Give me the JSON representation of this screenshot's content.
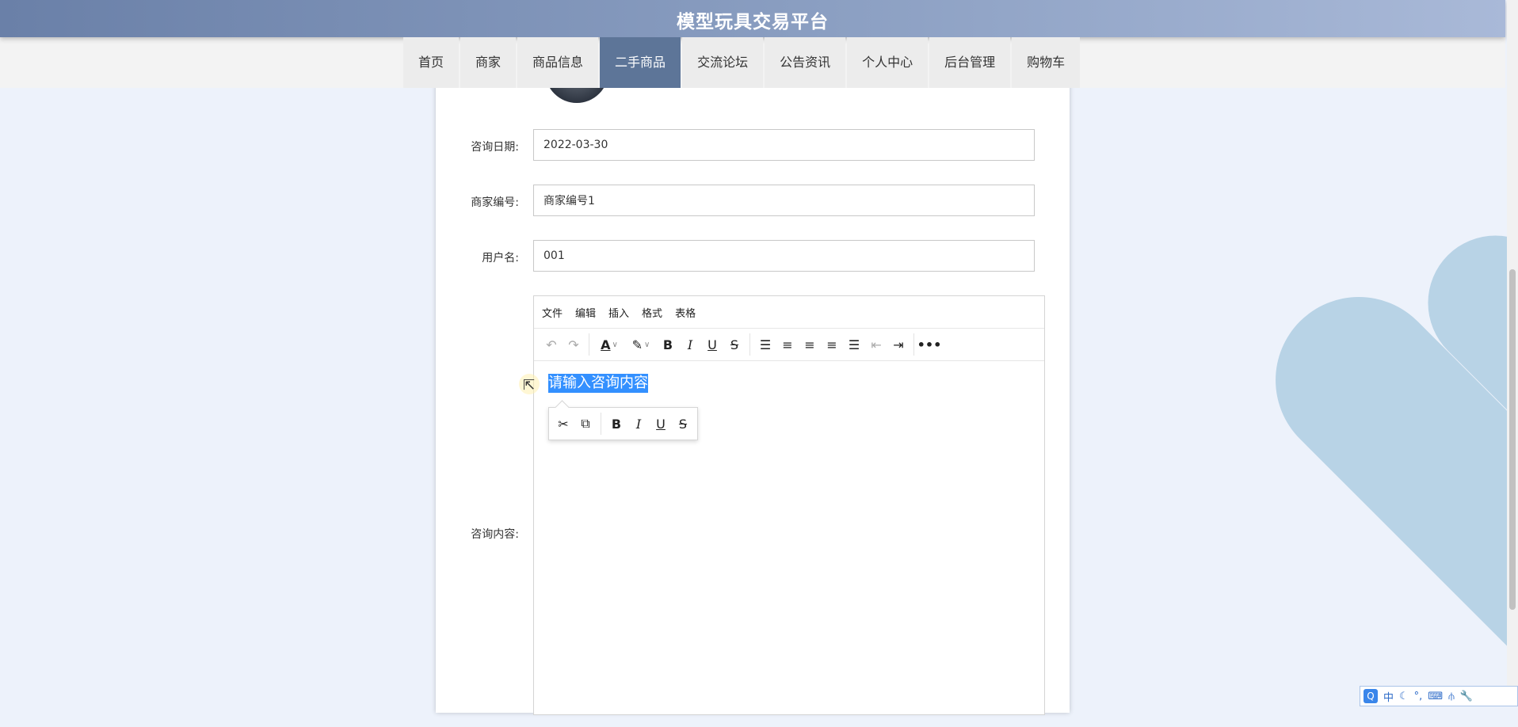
{
  "site": {
    "title": "模型玩具交易平台"
  },
  "nav": {
    "items": [
      {
        "label": "首页"
      },
      {
        "label": "商家"
      },
      {
        "label": "商品信息"
      },
      {
        "label": "二手商品",
        "active": true
      },
      {
        "label": "交流论坛"
      },
      {
        "label": "公告资讯"
      },
      {
        "label": "个人中心"
      },
      {
        "label": "后台管理"
      },
      {
        "label": "购物车"
      }
    ]
  },
  "form": {
    "date": {
      "label": "咨询日期:",
      "value": "2022-03-30"
    },
    "merchant_no": {
      "label": "商家编号:",
      "value": "商家编号1"
    },
    "username": {
      "label": "用户名:",
      "value": "001"
    },
    "content": {
      "label": "咨询内容:",
      "placeholder": "请输入咨询内容"
    }
  },
  "editor": {
    "menus": [
      "文件",
      "编辑",
      "插入",
      "格式",
      "表格"
    ]
  },
  "ime": {
    "mode": "中"
  },
  "colors": {
    "accent": "#5d7598",
    "selection": "#3390ff",
    "deco": "#b8d3e6"
  }
}
